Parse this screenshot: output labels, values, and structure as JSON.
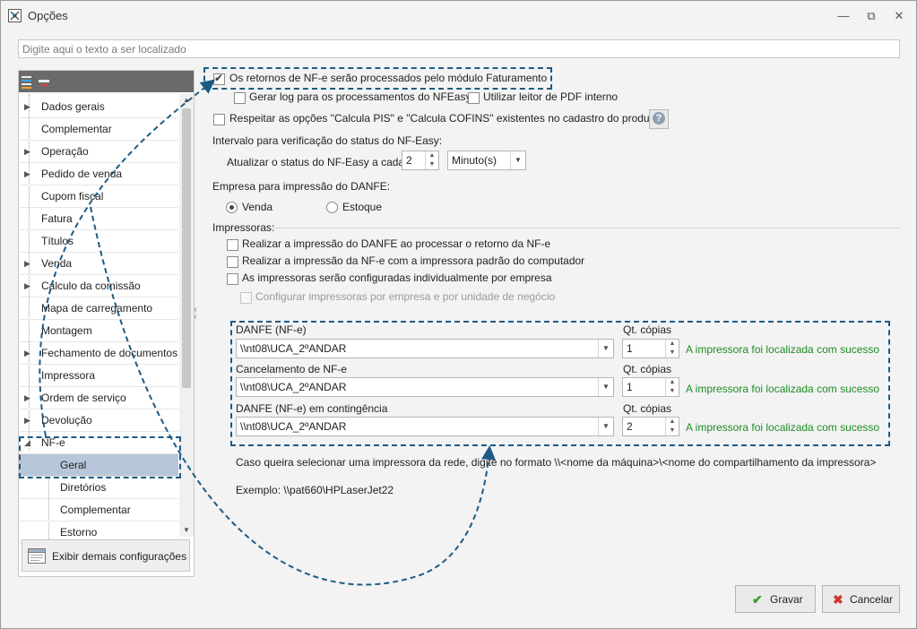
{
  "window": {
    "title": "Opções",
    "minimize_icon": "minimize-icon",
    "maximize_icon": "maximize-icon",
    "close_icon": "close-icon"
  },
  "search": {
    "placeholder": "Digite aqui o texto a ser localizado",
    "value": ""
  },
  "sidebar": {
    "items": [
      {
        "label": "Dados gerais",
        "expandable": true
      },
      {
        "label": "Complementar",
        "expandable": false
      },
      {
        "label": "Operação",
        "expandable": true
      },
      {
        "label": "Pedido de venda",
        "expandable": true
      },
      {
        "label": "Cupom fiscal",
        "expandable": false
      },
      {
        "label": "Fatura",
        "expandable": false
      },
      {
        "label": "Títulos",
        "expandable": false
      },
      {
        "label": "Venda",
        "expandable": true
      },
      {
        "label": "Cálculo da comissão",
        "expandable": true
      },
      {
        "label": "Mapa de carregamento",
        "expandable": false
      },
      {
        "label": "Montagem",
        "expandable": false
      },
      {
        "label": "Fechamento de documentos",
        "expandable": true
      },
      {
        "label": "Impressora",
        "expandable": false
      },
      {
        "label": "Ordem de serviço",
        "expandable": true
      },
      {
        "label": "Devolução",
        "expandable": true
      },
      {
        "label": "NF-e",
        "expandable": true,
        "expanded": true
      }
    ],
    "children": [
      {
        "label": "Geral",
        "selected": true
      },
      {
        "label": "Diretórios"
      },
      {
        "label": "Complementar"
      },
      {
        "label": "Estorno"
      }
    ],
    "more_button": "Exibir demais configurações"
  },
  "main": {
    "opt_retornos": {
      "label": "Os retornos de NF-e serão processados pelo módulo Faturamento",
      "checked": true
    },
    "opt_log": {
      "label": "Gerar log para os processamentos do NFEasy",
      "checked": false
    },
    "opt_pdf": {
      "label": "Utilizar leitor de PDF interno",
      "checked": false
    },
    "opt_pis": {
      "label": "Respeitar as opções \"Calcula PIS\" e \"Calcula COFINS\" existentes no cadastro do produto",
      "checked": false
    },
    "interval_heading": "Intervalo para verificação do status do NF-Easy:",
    "interval_label": "Atualizar o status do NF-Easy a cada:",
    "interval_value": "2",
    "interval_unit": "Minuto(s)",
    "empresa_heading": "Empresa para impressão do DANFE:",
    "radio_venda": {
      "label": "Venda",
      "selected": true
    },
    "radio_estoque": {
      "label": "Estoque",
      "selected": false
    },
    "impressoras_heading": "Impressoras:",
    "opt_danfe_retorno": {
      "label": "Realizar a impressão do DANFE ao processar o retorno da NF-e",
      "checked": false
    },
    "opt_padrao": {
      "label": "Realizar a impressão da NF-e com a impressora padrão do computador",
      "checked": false
    },
    "opt_individual": {
      "label": "As impressoras serão configuradas individualmente por empresa",
      "checked": false
    },
    "opt_por_empresa": {
      "label": "Configurar impressoras por empresa e por unidade de negócio",
      "checked": false,
      "disabled": true
    },
    "printers": [
      {
        "label": "DANFE (NF-e)",
        "printer": "\\\\nt08\\UCA_2ºANDAR",
        "copies_label": "Qt. cópias",
        "copies": "1",
        "status": "A impressora foi localizada com sucesso"
      },
      {
        "label": "Cancelamento de NF-e",
        "printer": "\\\\nt08\\UCA_2ºANDAR",
        "copies_label": "Qt. cópias",
        "copies": "1",
        "status": "A impressora foi localizada com sucesso"
      },
      {
        "label": "DANFE (NF-e) em contingência",
        "printer": "\\\\nt08\\UCA_2ºANDAR",
        "copies_label": "Qt. cópias",
        "copies": "2",
        "status": "A impressora foi localizada com sucesso"
      }
    ],
    "hint": "Caso queira selecionar uma impressora da rede, digite no formato \\\\<nome da máquina>\\<nome do compartilhamento da impressora>",
    "example": "Exemplo: \\\\pat660\\HPLaserJet22"
  },
  "footer": {
    "save_label": "Gravar",
    "cancel_label": "Cancelar"
  },
  "colors": {
    "accent_dashed": "#1d5b85",
    "success_text": "#1e8c24",
    "selected_row": "#b7c6d8"
  }
}
